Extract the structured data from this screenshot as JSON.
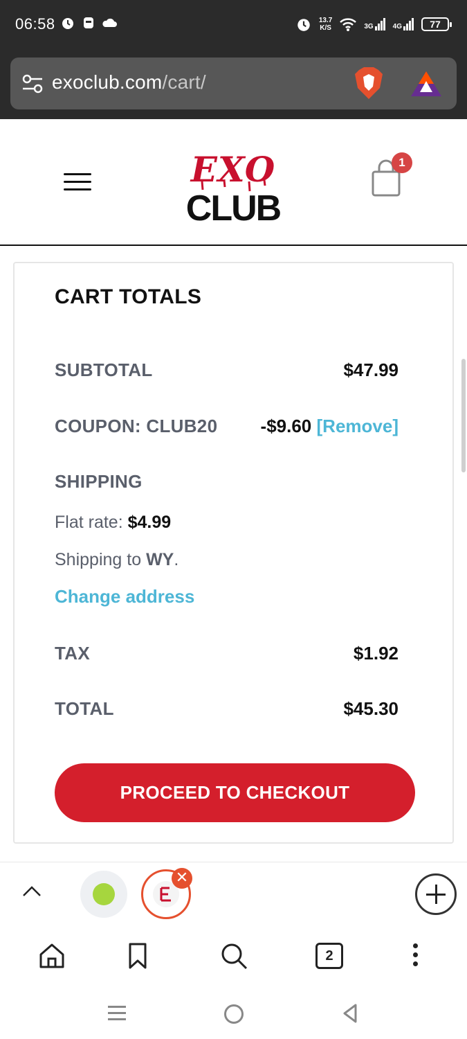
{
  "status_bar": {
    "time": "06:58",
    "speed_value": "13.7",
    "speed_unit": "K/S",
    "net1": "3G",
    "net2": "4G",
    "battery": "77"
  },
  "browser": {
    "url_domain": "exoclub.com",
    "url_path": "/cart/"
  },
  "site_header": {
    "logo_line1": "EXO",
    "logo_line2": "CLUB",
    "cart_count": "1"
  },
  "cart_totals": {
    "title": "CART TOTALS",
    "subtotal_label": "SUBTOTAL",
    "subtotal_value": "$47.99",
    "coupon_label": "COUPON: CLUB20",
    "coupon_value": "-$9.60",
    "coupon_remove": "[Remove]",
    "shipping_label": "SHIPPING",
    "flat_rate_label": "Flat rate:",
    "flat_rate_value": "$4.99",
    "shipping_to_prefix": "Shipping to",
    "shipping_to_state": "WY",
    "shipping_to_suffix": ".",
    "change_address": "Change address",
    "tax_label": "TAX",
    "tax_value": "$1.92",
    "total_label": "TOTAL",
    "total_value": "$45.30",
    "checkout_button": "PROCEED TO CHECKOUT"
  },
  "tabstrip": {
    "close_glyph": "✕"
  },
  "toolbar": {
    "tab_count": "2"
  },
  "colors": {
    "accent_red": "#d41f2c",
    "link_blue": "#4db6d6",
    "brave_orange": "#e5502e"
  }
}
